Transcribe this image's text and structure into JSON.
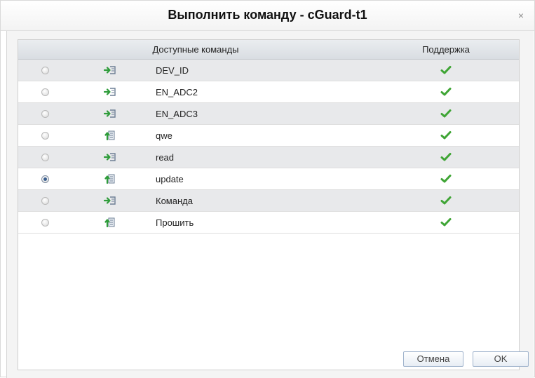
{
  "dialog": {
    "title": "Выполнить команду - cGuard-t1",
    "close_label": "×"
  },
  "grid": {
    "columns": {
      "commands": "Доступные команды",
      "support": "Поддержка"
    },
    "rows": [
      {
        "name": "DEV_ID",
        "icon": "arrow-in-icon",
        "selected": false,
        "supported": true
      },
      {
        "name": "EN_ADC2",
        "icon": "arrow-in-icon",
        "selected": false,
        "supported": true
      },
      {
        "name": "EN_ADC3",
        "icon": "arrow-in-icon",
        "selected": false,
        "supported": true
      },
      {
        "name": "qwe",
        "icon": "upload-doc-icon",
        "selected": false,
        "supported": true
      },
      {
        "name": "read",
        "icon": "arrow-in-icon",
        "selected": false,
        "supported": true
      },
      {
        "name": "update",
        "icon": "upload-doc-icon",
        "selected": true,
        "supported": true
      },
      {
        "name": "Команда",
        "icon": "arrow-in-icon",
        "selected": false,
        "supported": true
      },
      {
        "name": "Прошить",
        "icon": "upload-doc-icon",
        "selected": false,
        "supported": true
      }
    ]
  },
  "buttons": {
    "cancel_label": "Отмена",
    "ok_label": "OK"
  },
  "colors": {
    "check": "#3fa535",
    "icon_green": "#2e9c3a"
  }
}
